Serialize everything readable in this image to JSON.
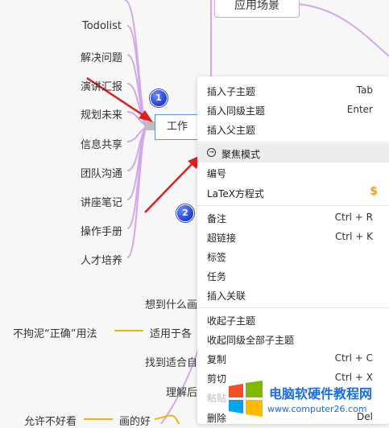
{
  "top_node": "应用场景",
  "left_branch": [
    "Todolist",
    "解决问题",
    "演讲汇报",
    "规划未来",
    "信息共享",
    "团队沟通",
    "讲座笔记",
    "操作手册",
    "人才培养"
  ],
  "selected_node": "工作",
  "bottom_nodes": {
    "n1": "想到什么画",
    "n2_left": "不拘泥“正确”用法",
    "n2": "适用于各",
    "n3": "找到适合自",
    "n4": "理解后",
    "n5_left": "允许不好看",
    "n5": "画的好"
  },
  "badges": [
    "1",
    "2"
  ],
  "context_menu": {
    "items": [
      {
        "label": "插入子主题",
        "shortcut": "Tab"
      },
      {
        "label": "插入同级主题",
        "shortcut": "Enter"
      },
      {
        "label": "插入父主题",
        "shortcut": ""
      },
      {
        "label": "聚焦模式",
        "shortcut": "",
        "icon": "focus-icon",
        "active": true
      },
      {
        "label": "编号",
        "shortcut": ""
      },
      {
        "label": "LaTeX方程式",
        "shortcut": "",
        "icon": "dollar-icon"
      },
      {
        "label": "备注",
        "shortcut": "Ctrl + R"
      },
      {
        "label": "超链接",
        "shortcut": "Ctrl + K"
      },
      {
        "label": "标签",
        "shortcut": ""
      },
      {
        "label": "任务",
        "shortcut": ""
      },
      {
        "label": "插入关联",
        "shortcut": ""
      },
      {
        "label": "收起子主题",
        "shortcut": ""
      },
      {
        "label": "收起同级全部子主题",
        "shortcut": ""
      },
      {
        "label": "复制",
        "shortcut": "Ctrl + C"
      },
      {
        "label": "剪切",
        "shortcut": "Ctrl + X"
      },
      {
        "label": "粘贴",
        "shortcut": "",
        "disabled": true
      },
      {
        "label": "删除",
        "shortcut": "Del"
      }
    ]
  },
  "watermark": {
    "title": "电脑软硬件教程网",
    "url": "www.computer26.com"
  },
  "colors": {
    "branch_purple": "#d2a8e8",
    "branch_orange": "#f5b400",
    "arrow_red": "#e02020",
    "selection_blue": "#5b9bd5",
    "menu_accent_green": "#3cc98a"
  }
}
